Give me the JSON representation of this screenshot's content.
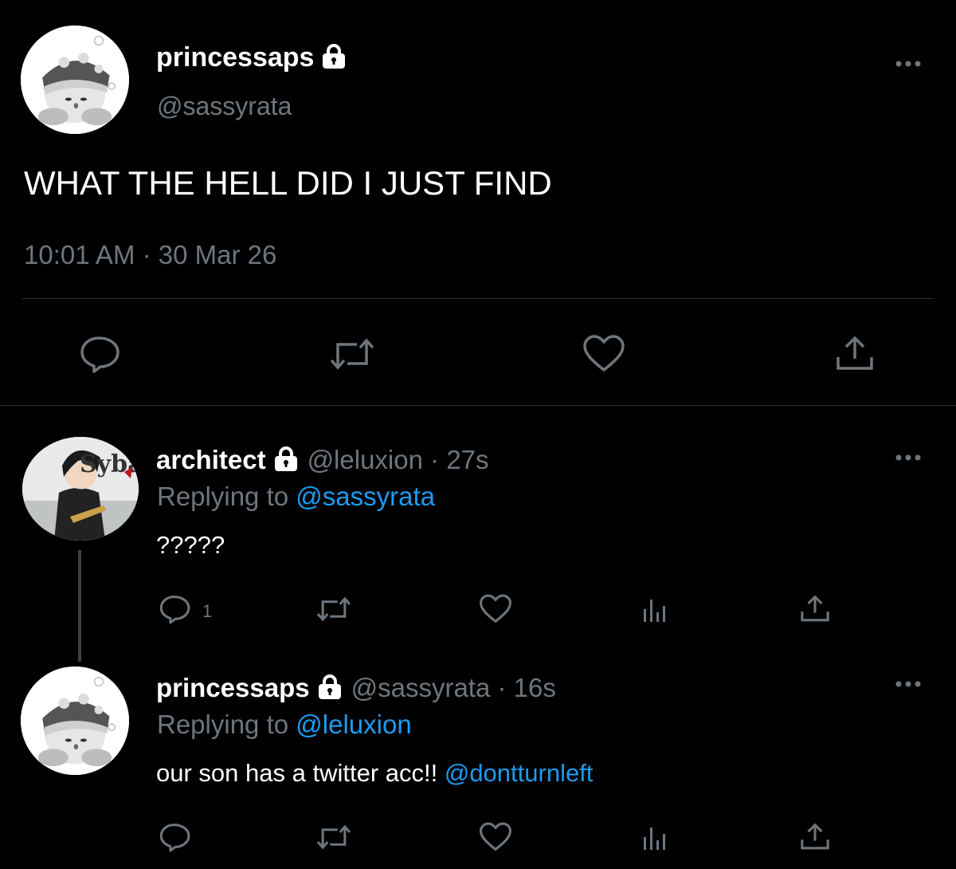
{
  "main_tweet": {
    "display_name": "princessaps",
    "handle": "@sassyrata",
    "text": "WHAT THE HELL DID I JUST FIND",
    "time": "10:01 AM",
    "date": "30 Mar 26",
    "separator": "·"
  },
  "reply1": {
    "display_name": "architect",
    "handle": "@leluxion",
    "separator": "·",
    "age": "27s",
    "replying_prefix": "Replying to",
    "replying_to": "@sassyrata",
    "text": "?????",
    "reply_count": "1",
    "avatar_text": "Sybau"
  },
  "reply2": {
    "display_name": "princessaps",
    "handle": "@sassyrata",
    "separator": "·",
    "age": "16s",
    "replying_prefix": "Replying to",
    "replying_to": "@leluxion",
    "text": "our son has a twitter acc!!",
    "mention": "@dontturnleft"
  },
  "colors": {
    "background": "#000000",
    "muted": "#6e767d",
    "link": "#1d9bf0",
    "divider": "#2f3336"
  },
  "icons": {
    "reply": "reply-icon",
    "retweet": "retweet-icon",
    "like": "heart-icon",
    "share": "share-icon",
    "analytics": "analytics-icon",
    "more": "more-icon",
    "lock": "lock-icon"
  }
}
